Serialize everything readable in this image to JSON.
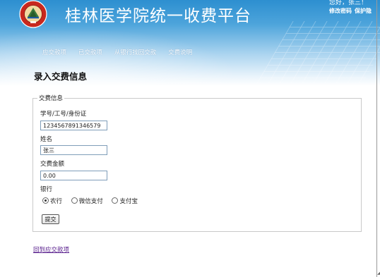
{
  "header": {
    "logo_text": "桂林医学院",
    "logo_subtext": "GUILIN MEDICAL UNIVERSITY",
    "logo_year": "1958",
    "site_title": "桂林医学院统一收费平台",
    "greeting": "您好，张三！",
    "change_password": "修改密码",
    "protect": "保护隐"
  },
  "nav": {
    "items": [
      "应交款项",
      "已交款项",
      "从银行找回交款",
      "交费说明"
    ]
  },
  "page": {
    "heading": "录入交费信息"
  },
  "form": {
    "legend": "交费信息",
    "id_label": "学号/工号/身份证",
    "id_value": "1234567891346579",
    "name_label": "姓名",
    "name_value": "张三",
    "amount_label": "交费金额",
    "amount_value": "0.00",
    "bank_label": "银行",
    "bank_options": [
      "农行",
      "微信支付",
      "支付宝"
    ],
    "selected_bank": "农行",
    "submit_label": "提交"
  },
  "footer": {
    "back_link": "回到应交款项"
  },
  "colors": {
    "banner_top": "#2d8fd0",
    "banner_bottom": "#ffffff",
    "link_visited": "#551a8b",
    "input_border": "#7f9db9"
  }
}
